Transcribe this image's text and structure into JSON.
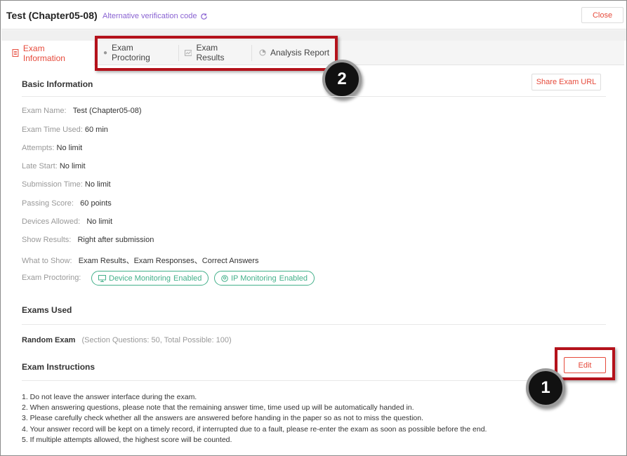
{
  "header": {
    "title": "Test (Chapter05-08)",
    "alt_code_label": "Alternative verification code",
    "alt_code_icon": "refresh-icon",
    "close_label": "Close"
  },
  "tabs": [
    {
      "label": "Exam Information",
      "icon": "document-icon",
      "active": true
    },
    {
      "label": "Exam Proctoring",
      "icon": "proctor-icon",
      "active": false
    },
    {
      "label": "Exam Results",
      "icon": "chart-line-icon",
      "active": false
    },
    {
      "label": "Analysis Report",
      "icon": "pie-icon",
      "active": false
    }
  ],
  "callouts": {
    "one": "1",
    "two": "2"
  },
  "basic_info": {
    "title": "Basic Information",
    "share_label": "Share Exam URL",
    "rows": [
      {
        "label": "Exam Name:",
        "value": "Test (Chapter05-08)"
      },
      {
        "label": "Exam Time Used:",
        "value": "60 min"
      },
      {
        "label": "Attempts:",
        "value": "No limit"
      },
      {
        "label": "Late Start:",
        "value": "No limit"
      },
      {
        "label": "Submission Time:",
        "value": "No limit"
      },
      {
        "label": "Passing Score:",
        "value": "60 points"
      },
      {
        "label": "Devices Allowed:",
        "value": "No limit"
      },
      {
        "label": "Show Results:",
        "value": "Right after submission"
      },
      {
        "label": "What to Show:",
        "value": "Exam Results、Exam Responses、Correct Answers"
      }
    ],
    "proctoring_label": "Exam Proctoring:",
    "pills": [
      {
        "name": "Device Monitoring",
        "status": "Enabled",
        "icon": "monitor-icon"
      },
      {
        "name": "IP Monitoring",
        "status": "Enabled",
        "icon": "ip-icon"
      }
    ]
  },
  "exams_used": {
    "title": "Exams Used",
    "type": "Random Exam",
    "detail": "(Section Questions: 50, Total Possible: 100)"
  },
  "instructions": {
    "title": "Exam Instructions",
    "edit_label": "Edit",
    "lines": [
      "1. Do not leave the answer interface during the exam.",
      "2. When answering questions, please note that the remaining answer time, time used up will be automatically handed in.",
      " 3. Please carefully check whether all the answers are answered before handing in the paper so as not to miss the question.",
      " 4. Your answer record will be kept on a timely record, if interrupted due to a fault, please re-enter the exam as soon as possible before the end.",
      " 5. If multiple attempts allowed, the highest score will be counted."
    ]
  },
  "colors": {
    "accent": "#e64a3b",
    "callout": "#b4121b",
    "green": "#43b08a",
    "link": "#8a63d2"
  }
}
